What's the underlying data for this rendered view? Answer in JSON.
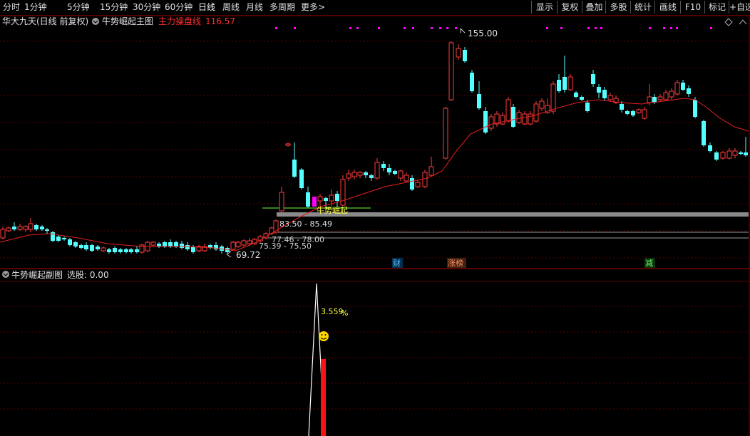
{
  "toolbar": {
    "left_items": [
      "分时",
      "1分钟",
      "5分钟",
      "15分钟",
      "30分钟",
      "60分钟",
      "日线",
      "周线",
      "月线",
      "多周期",
      "更多"
    ],
    "right_items": [
      "显示",
      "复权",
      "叠加",
      "多股",
      "统计",
      "画线",
      "F10",
      "标记",
      "+自选"
    ],
    "more_arrow": ">"
  },
  "main": {
    "title": "华大九天(日线 前复权)",
    "indicator_name": "牛势崛起主图",
    "line_label": "主力操盘线",
    "line_value": "116.57",
    "high_label": "155.00",
    "low_label": "69.72",
    "signal_text": "牛势崛起",
    "zones": [
      "83.50 - 85.49",
      "77.46 - 78.00",
      "75.39 - 75.50"
    ],
    "event_tags": [
      "财",
      "涨榜",
      "减"
    ]
  },
  "sub": {
    "title": "牛势崛起副图",
    "select_label": "选股: 0.00",
    "peak_value": "3.559",
    "peak_unit": "%"
  },
  "colors": {
    "up": "#ff3c3c",
    "down": "#54ffff",
    "ma": "#e62020",
    "zone_bar": "#8a8a8a",
    "text_yellow": "#ffff40",
    "magenta": "#ff00ff",
    "red_label": "#ff3030"
  }
}
